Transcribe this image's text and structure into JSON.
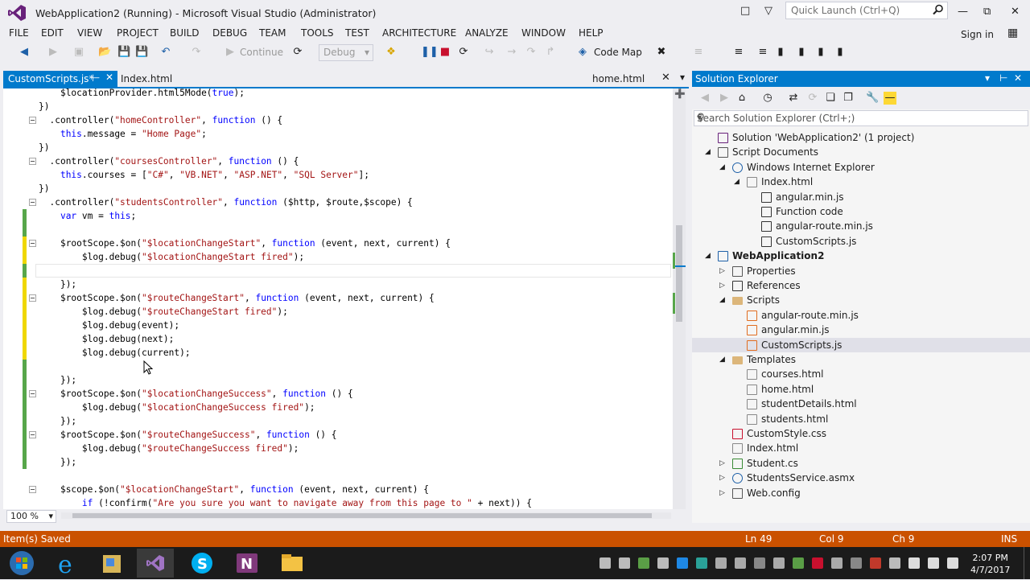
{
  "window": {
    "title": "WebApplication2 (Running) - Microsoft Visual Studio (Administrator)",
    "quick_launch_placeholder": "Quick Launch (Ctrl+Q)",
    "sign_in": "Sign in"
  },
  "menu": [
    "FILE",
    "EDIT",
    "VIEW",
    "PROJECT",
    "BUILD",
    "DEBUG",
    "TEAM",
    "TOOLS",
    "TEST",
    "ARCHITECTURE",
    "ANALYZE",
    "WINDOW",
    "HELP"
  ],
  "toolbar": {
    "continue_label": "Continue",
    "config_value": "Debug",
    "code_map_label": "Code Map"
  },
  "tabs": {
    "active": "CustomScripts.js*",
    "second": "Index.html",
    "preview": "home.html"
  },
  "editor": {
    "zoom": "100 %",
    "lines": [
      {
        "indent": "    ",
        "parts": [
          [
            "t",
            "$locationProvider.html5Mode("
          ],
          [
            "k",
            "true"
          ],
          [
            "t",
            ");"
          ]
        ]
      },
      {
        "indent": "",
        "parts": [
          [
            "t",
            "})"
          ]
        ]
      },
      {
        "indent": "  ",
        "parts": [
          [
            "t",
            ".controller("
          ],
          [
            "s",
            "\"homeController\""
          ],
          [
            "t",
            ", "
          ],
          [
            "k",
            "function"
          ],
          [
            "t",
            " () {"
          ]
        ]
      },
      {
        "indent": "    ",
        "parts": [
          [
            "k",
            "this"
          ],
          [
            "t",
            ".message = "
          ],
          [
            "s",
            "\"Home Page\""
          ],
          [
            "t",
            ";"
          ]
        ]
      },
      {
        "indent": "",
        "parts": [
          [
            "t",
            "})"
          ]
        ]
      },
      {
        "indent": "  ",
        "parts": [
          [
            "t",
            ".controller("
          ],
          [
            "s",
            "\"coursesController\""
          ],
          [
            "t",
            ", "
          ],
          [
            "k",
            "function"
          ],
          [
            "t",
            " () {"
          ]
        ]
      },
      {
        "indent": "    ",
        "parts": [
          [
            "k",
            "this"
          ],
          [
            "t",
            ".courses = ["
          ],
          [
            "s",
            "\"C#\""
          ],
          [
            "t",
            ", "
          ],
          [
            "s",
            "\"VB.NET\""
          ],
          [
            "t",
            ", "
          ],
          [
            "s",
            "\"ASP.NET\""
          ],
          [
            "t",
            ", "
          ],
          [
            "s",
            "\"SQL Server\""
          ],
          [
            "t",
            "];"
          ]
        ]
      },
      {
        "indent": "",
        "parts": [
          [
            "t",
            "})"
          ]
        ]
      },
      {
        "indent": "  ",
        "parts": [
          [
            "t",
            ".controller("
          ],
          [
            "s",
            "\"studentsController\""
          ],
          [
            "t",
            ", "
          ],
          [
            "k",
            "function"
          ],
          [
            "t",
            " ($http, $route,$scope) {"
          ]
        ]
      },
      {
        "indent": "    ",
        "parts": [
          [
            "k",
            "var"
          ],
          [
            "t",
            " vm = "
          ],
          [
            "k",
            "this"
          ],
          [
            "t",
            ";"
          ]
        ]
      },
      {
        "indent": "",
        "parts": []
      },
      {
        "indent": "    ",
        "parts": [
          [
            "t",
            "$rootScope.$on("
          ],
          [
            "s",
            "\"$locationChangeStart\""
          ],
          [
            "t",
            ", "
          ],
          [
            "k",
            "function"
          ],
          [
            "t",
            " (event, next, current) {"
          ]
        ]
      },
      {
        "indent": "        ",
        "parts": [
          [
            "t",
            "$log.debug("
          ],
          [
            "s",
            "\"$locationChangeStart fired\""
          ],
          [
            "t",
            ");"
          ]
        ]
      },
      {
        "indent": "",
        "parts": []
      },
      {
        "indent": "    ",
        "parts": [
          [
            "t",
            "});"
          ]
        ]
      },
      {
        "indent": "    ",
        "parts": [
          [
            "t",
            "$rootScope.$on("
          ],
          [
            "s",
            "\"$routeChangeStart\""
          ],
          [
            "t",
            ", "
          ],
          [
            "k",
            "function"
          ],
          [
            "t",
            " (event, next, current) {"
          ]
        ]
      },
      {
        "indent": "        ",
        "parts": [
          [
            "t",
            "$log.debug("
          ],
          [
            "s",
            "\"$routeChangeStart fired\""
          ],
          [
            "t",
            ");"
          ]
        ]
      },
      {
        "indent": "        ",
        "parts": [
          [
            "t",
            "$log.debug(event);"
          ]
        ]
      },
      {
        "indent": "        ",
        "parts": [
          [
            "t",
            "$log.debug(next);"
          ]
        ]
      },
      {
        "indent": "        ",
        "parts": [
          [
            "t",
            "$log.debug(current);"
          ]
        ]
      },
      {
        "indent": "",
        "parts": []
      },
      {
        "indent": "    ",
        "parts": [
          [
            "t",
            "});"
          ]
        ]
      },
      {
        "indent": "    ",
        "parts": [
          [
            "t",
            "$rootScope.$on("
          ],
          [
            "s",
            "\"$locationChangeSuccess\""
          ],
          [
            "t",
            ", "
          ],
          [
            "k",
            "function"
          ],
          [
            "t",
            " () {"
          ]
        ]
      },
      {
        "indent": "        ",
        "parts": [
          [
            "t",
            "$log.debug("
          ],
          [
            "s",
            "\"$locationChangeSuccess fired\""
          ],
          [
            "t",
            ");"
          ]
        ]
      },
      {
        "indent": "    ",
        "parts": [
          [
            "t",
            "});"
          ]
        ]
      },
      {
        "indent": "    ",
        "parts": [
          [
            "t",
            "$rootScope.$on("
          ],
          [
            "s",
            "\"$routeChangeSuccess\""
          ],
          [
            "t",
            ", "
          ],
          [
            "k",
            "function"
          ],
          [
            "t",
            " () {"
          ]
        ]
      },
      {
        "indent": "        ",
        "parts": [
          [
            "t",
            "$log.debug("
          ],
          [
            "s",
            "\"$routeChangeSuccess fired\""
          ],
          [
            "t",
            ");"
          ]
        ]
      },
      {
        "indent": "    ",
        "parts": [
          [
            "t",
            "});"
          ]
        ]
      },
      {
        "indent": "",
        "parts": []
      },
      {
        "indent": "    ",
        "parts": [
          [
            "t",
            "$scope.$on("
          ],
          [
            "s",
            "\"$locationChangeStart\""
          ],
          [
            "t",
            ", "
          ],
          [
            "k",
            "function"
          ],
          [
            "t",
            " (event, next, current) {"
          ]
        ]
      },
      {
        "indent": "        ",
        "parts": [
          [
            "k",
            "if"
          ],
          [
            "t",
            " (!confirm("
          ],
          [
            "s",
            "\"Are you sure you want to navigate away from this page to \""
          ],
          [
            "t",
            " + next)) {"
          ]
        ]
      }
    ]
  },
  "solution_explorer": {
    "title": "Solution Explorer",
    "search_placeholder": "Search Solution Explorer (Ctrl+;)",
    "nodes": [
      {
        "label": "Solution 'WebApplication2' (1 project)",
        "level": 0,
        "exp": "",
        "icon": "solution-icon",
        "bold": false
      },
      {
        "label": "Script Documents",
        "level": 0,
        "exp": "open",
        "icon": "script-documents-icon",
        "bold": false
      },
      {
        "label": "Windows Internet Explorer",
        "level": 1,
        "exp": "open",
        "icon": "browser-icon",
        "bold": false
      },
      {
        "label": "Index.html",
        "level": 2,
        "exp": "open",
        "icon": "html-file-icon",
        "bold": false
      },
      {
        "label": "angular.min.js",
        "level": 3,
        "exp": "",
        "icon": "js-file-icon",
        "bold": false
      },
      {
        "label": "Function code",
        "level": 3,
        "exp": "",
        "icon": "js-file-icon",
        "bold": false
      },
      {
        "label": "angular-route.min.js",
        "level": 3,
        "exp": "",
        "icon": "js-file-icon",
        "bold": false
      },
      {
        "label": "CustomScripts.js",
        "level": 3,
        "exp": "",
        "icon": "js-file-icon",
        "bold": false
      },
      {
        "label": "WebApplication2",
        "level": 0,
        "exp": "open",
        "icon": "web-project-icon",
        "bold": true
      },
      {
        "label": "Properties",
        "level": 1,
        "exp": "closed",
        "icon": "properties-icon",
        "bold": false
      },
      {
        "label": "References",
        "level": 1,
        "exp": "closed",
        "icon": "references-icon",
        "bold": false
      },
      {
        "label": "Scripts",
        "level": 1,
        "exp": "open",
        "icon": "folder-icon",
        "bold": false
      },
      {
        "label": "angular-route.min.js",
        "level": 2,
        "exp": "",
        "icon": "js-file-icon",
        "bold": false
      },
      {
        "label": "angular.min.js",
        "level": 2,
        "exp": "",
        "icon": "js-file-icon",
        "bold": false
      },
      {
        "label": "CustomScripts.js",
        "level": 2,
        "exp": "",
        "icon": "js-file-icon",
        "bold": false,
        "selected": true
      },
      {
        "label": "Templates",
        "level": 1,
        "exp": "open",
        "icon": "folder-icon",
        "bold": false
      },
      {
        "label": "courses.html",
        "level": 2,
        "exp": "",
        "icon": "html-file-icon",
        "bold": false
      },
      {
        "label": "home.html",
        "level": 2,
        "exp": "",
        "icon": "html-file-icon",
        "bold": false
      },
      {
        "label": "studentDetails.html",
        "level": 2,
        "exp": "",
        "icon": "html-file-icon",
        "bold": false
      },
      {
        "label": "students.html",
        "level": 2,
        "exp": "",
        "icon": "html-file-icon",
        "bold": false
      },
      {
        "label": "CustomStyle.css",
        "level": 1,
        "exp": "",
        "icon": "css-file-icon",
        "bold": false
      },
      {
        "label": "Index.html",
        "level": 1,
        "exp": "",
        "icon": "html-file-icon",
        "bold": false
      },
      {
        "label": "Student.cs",
        "level": 1,
        "exp": "closed",
        "icon": "csharp-file-icon",
        "bold": false
      },
      {
        "label": "StudentsService.asmx",
        "level": 1,
        "exp": "closed",
        "icon": "service-file-icon",
        "bold": false
      },
      {
        "label": "Web.config",
        "level": 1,
        "exp": "closed",
        "icon": "config-file-icon",
        "bold": false
      }
    ]
  },
  "status": {
    "message": "Item(s) Saved",
    "ln": "Ln 49",
    "col": "Col 9",
    "ch": "Ch 9",
    "mode": "INS"
  },
  "taskbar": {
    "time": "2:07 PM",
    "date": "4/7/2017",
    "apps": [
      "start",
      "internet-explorer",
      "file-tool",
      "visual-studio",
      "skype",
      "onenote",
      "file-explorer"
    ]
  },
  "colors": {
    "accent": "#007acc",
    "status_bar": "#ca5100",
    "keyword": "#0000ff",
    "string": "#a31515",
    "change_saved": "#57a64a",
    "change_unsaved": "#efd700"
  }
}
